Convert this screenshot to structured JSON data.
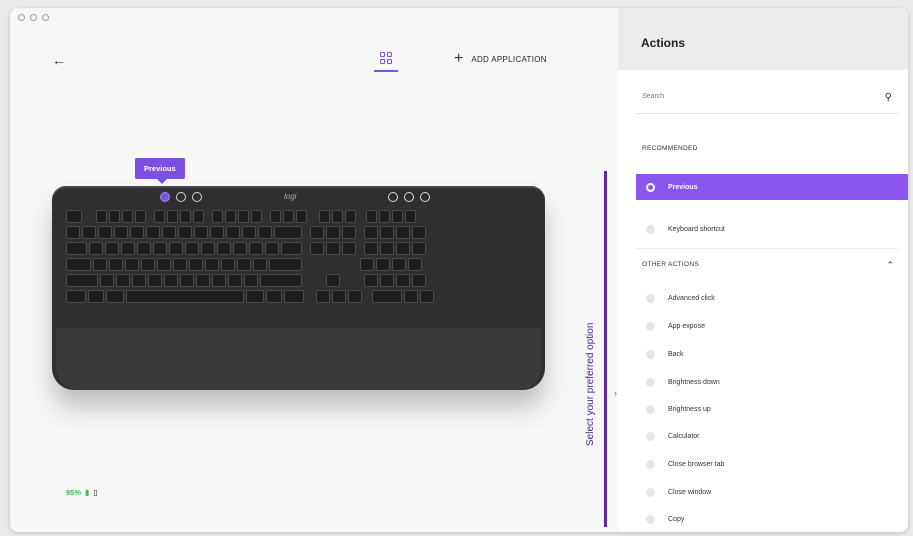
{
  "header": {
    "back_icon": "arrow-left-icon",
    "grid_icon": "grid-icon",
    "add_application_label": "ADD APPLICATION"
  },
  "tooltip": {
    "label": "Previous"
  },
  "keyboard": {
    "logo": "logi"
  },
  "annotation": {
    "text": "Select your preferred option"
  },
  "battery": {
    "percent": "95%"
  },
  "panel": {
    "title": "Actions",
    "search_placeholder": "Search",
    "recommended_heading": "RECOMMENDED",
    "recommended": [
      {
        "label": "Previous",
        "selected": true
      },
      {
        "label": "Keyboard shortcut",
        "selected": false
      }
    ],
    "other_heading": "OTHER ACTIONS",
    "other": [
      {
        "label": "Advanced click"
      },
      {
        "label": "App expose"
      },
      {
        "label": "Back"
      },
      {
        "label": "Brightness down"
      },
      {
        "label": "Brightness up"
      },
      {
        "label": "Calculator"
      },
      {
        "label": "Close browser tab"
      },
      {
        "label": "Close window"
      },
      {
        "label": "Copy"
      }
    ]
  },
  "colors": {
    "accent": "#8b55f0",
    "annotation_line": "#5b2aa8",
    "battery_green": "#3fbf4f"
  }
}
